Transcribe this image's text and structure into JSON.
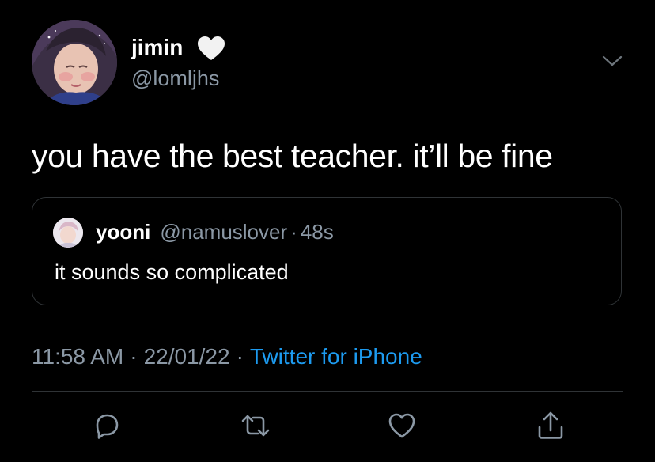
{
  "colors": {
    "background": "#000000",
    "text_primary": "#ffffff",
    "text_secondary": "#8b98a5",
    "link": "#1d9bf0",
    "border": "#2f3336"
  },
  "author": {
    "display_name": "jimin",
    "badge_icon": "white-heart-icon",
    "handle": "@lomljhs",
    "avatar": "profile-photo"
  },
  "tweet": {
    "text": "you have the best teacher. it’ll be fine"
  },
  "quoted_tweet": {
    "display_name": "yooni",
    "handle": "@namuslover",
    "separator": "·",
    "time": "48s",
    "text": "it sounds so complicated"
  },
  "meta": {
    "time": "11:58 AM",
    "separator": "·",
    "date": "22/01/22",
    "source": "Twitter for iPhone"
  },
  "actions": [
    "reply-icon",
    "retweet-icon",
    "like-icon",
    "share-icon"
  ]
}
